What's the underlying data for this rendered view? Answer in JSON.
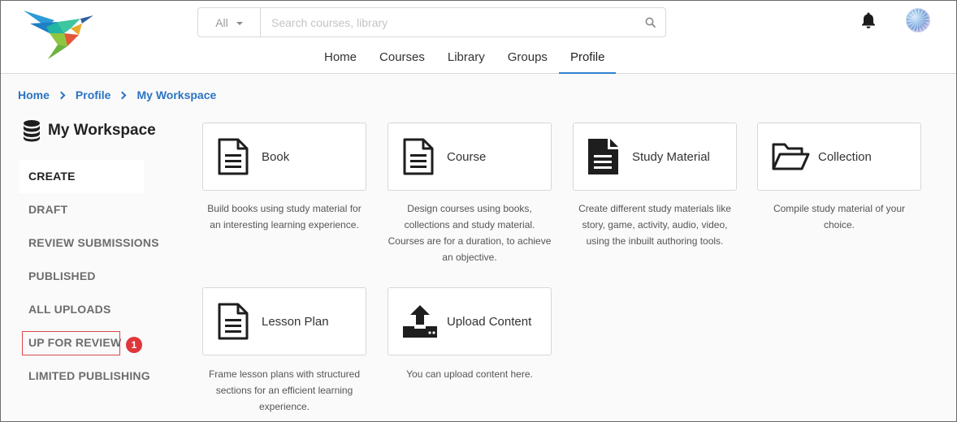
{
  "header": {
    "search": {
      "filter_value": "All",
      "placeholder": "Search courses, library",
      "value": ""
    },
    "nav": [
      {
        "label": "Home",
        "active": false
      },
      {
        "label": "Courses",
        "active": false
      },
      {
        "label": "Library",
        "active": false
      },
      {
        "label": "Groups",
        "active": false
      },
      {
        "label": "Profile",
        "active": true
      }
    ],
    "icons": {
      "logo": "bird-logo",
      "search": "search-icon",
      "bell": "bell-icon",
      "avatar": "avatar"
    }
  },
  "breadcrumb": [
    "Home",
    "Profile",
    "My Workspace"
  ],
  "workspace": {
    "title": "My Workspace",
    "icon": "database-icon"
  },
  "sidebar": {
    "items": [
      {
        "label": "CREATE",
        "active": true
      },
      {
        "label": "DRAFT",
        "active": false
      },
      {
        "label": "REVIEW SUBMISSIONS",
        "active": false
      },
      {
        "label": "PUBLISHED",
        "active": false
      },
      {
        "label": "ALL UPLOADS",
        "active": false
      },
      {
        "label": "UP FOR REVIEW",
        "active": false,
        "badge": "1"
      },
      {
        "label": "LIMITED PUBLISHING",
        "active": false
      }
    ]
  },
  "cards": [
    {
      "label": "Book",
      "icon": "document-outline-icon",
      "description": "Build books using study material for an interesting learning experience."
    },
    {
      "label": "Course",
      "icon": "document-outline-icon",
      "description": "Design courses using books, collections and study material. Courses are for a duration, to achieve an objective."
    },
    {
      "label": "Study Material",
      "icon": "document-filled-icon",
      "description": "Create different study materials like story, game, activity, audio, video, using the inbuilt authoring tools."
    },
    {
      "label": "Collection",
      "icon": "folder-open-icon",
      "description": "Compile study material of your choice."
    },
    {
      "label": "Lesson Plan",
      "icon": "document-outline-icon",
      "description": "Frame lesson plans with structured sections for an efficient learning experience."
    },
    {
      "label": "Upload Content",
      "icon": "upload-icon",
      "description": "You can upload content here."
    }
  ],
  "colors": {
    "accent": "#2f7fd0",
    "link": "#2a73c2",
    "badge": "#e0363b",
    "highlight_border": "#d64a4a"
  }
}
